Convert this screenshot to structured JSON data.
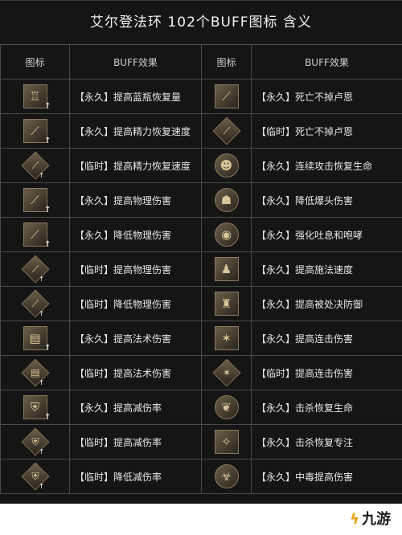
{
  "title": "艾尔登法环 102个BUFF图标 含义",
  "headers": {
    "icon": "图标",
    "effect": "BUFF效果"
  },
  "rows": [
    {
      "left": {
        "text": "【永久】提高蓝瓶恢复量",
        "icon": "flask-icon",
        "glyph": "♖",
        "up": true
      },
      "right": {
        "text": "【永久】死亡不掉卢恩",
        "icon": "staff-icon",
        "glyph": "⟋",
        "up": false
      }
    },
    {
      "left": {
        "text": "【永久】提高精力恢复速度",
        "icon": "fang-icon",
        "glyph": "⟋",
        "up": true
      },
      "right": {
        "text": "【临时】死亡不掉卢恩",
        "icon": "staff-diamond-icon",
        "glyph": "⟋",
        "up": false
      }
    },
    {
      "left": {
        "text": "【临时】提高精力恢复速度",
        "icon": "fang-diamond-icon",
        "glyph": "⟋",
        "up": true
      },
      "right": {
        "text": "【永久】连续攻击恢复生命",
        "icon": "face-icon",
        "glyph": "☻",
        "up": false
      }
    },
    {
      "left": {
        "text": "【永久】提高物理伤害",
        "icon": "sword-icon",
        "glyph": "⟋",
        "up": true
      },
      "right": {
        "text": "【永久】降低爆头伤害",
        "icon": "head-icon",
        "glyph": "☗",
        "up": false
      }
    },
    {
      "left": {
        "text": "【永久】降低物理伤害",
        "icon": "sword-down-icon",
        "glyph": "⟋",
        "up": true
      },
      "right": {
        "text": "【永久】强化吐息和咆哮",
        "icon": "breath-icon",
        "glyph": "◉",
        "up": false
      }
    },
    {
      "left": {
        "text": "【临时】提高物理伤害",
        "icon": "sword-diamond-icon",
        "glyph": "⟋",
        "up": true
      },
      "right": {
        "text": "【永久】提高施法速度",
        "icon": "caster-icon",
        "glyph": "♟",
        "up": false
      }
    },
    {
      "left": {
        "text": "【临时】降低物理伤害",
        "icon": "sword-down-diamond-icon",
        "glyph": "⟋",
        "up": true
      },
      "right": {
        "text": "【永久】提高被处决防御",
        "icon": "armor-icon",
        "glyph": "♜",
        "up": false
      }
    },
    {
      "left": {
        "text": "【永久】提高法术伤害",
        "icon": "scroll-icon",
        "glyph": "▤",
        "up": true
      },
      "right": {
        "text": "【永久】提高连击伤害",
        "icon": "claw-icon",
        "glyph": "✶",
        "up": false
      }
    },
    {
      "left": {
        "text": "【临时】提高法术伤害",
        "icon": "scroll-diamond-icon",
        "glyph": "▤",
        "up": true
      },
      "right": {
        "text": "【临时】提高连击伤害",
        "icon": "claw-diamond-icon",
        "glyph": "✶",
        "up": false
      }
    },
    {
      "left": {
        "text": "【永久】提高减伤率",
        "icon": "shield-icon",
        "glyph": "⛨",
        "up": true
      },
      "right": {
        "text": "【永久】击杀恢复生命",
        "icon": "heart-icon",
        "glyph": "❦",
        "up": false
      }
    },
    {
      "left": {
        "text": "【临时】提高减伤率",
        "icon": "shield-diamond-icon",
        "glyph": "⛨",
        "up": true
      },
      "right": {
        "text": "【永久】击杀恢复专注",
        "icon": "focus-icon",
        "glyph": "✧",
        "up": false
      }
    },
    {
      "left": {
        "text": "【临时】降低减伤率",
        "icon": "shield-down-diamond-icon",
        "glyph": "⛨",
        "up": true
      },
      "right": {
        "text": "【永久】中毒提高伤害",
        "icon": "poison-icon",
        "glyph": "☣",
        "up": false
      }
    }
  ],
  "logo": {
    "mark": "ϟ",
    "text": "九游"
  }
}
